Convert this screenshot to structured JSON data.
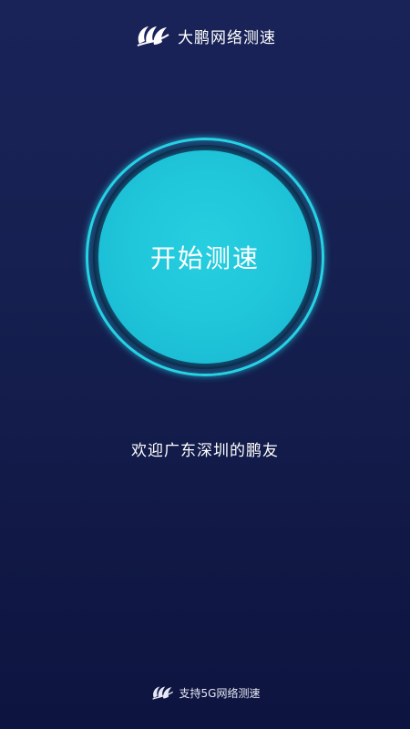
{
  "header": {
    "logo_icon": "dapeng-logo-icon",
    "title": "大鹏网络测速"
  },
  "speedtest": {
    "start_label": "开始测速",
    "accent_color": "#1fc4d9",
    "ring_color": "#27d3e6"
  },
  "welcome_text": "欢迎广东深圳的鹏友",
  "footer": {
    "logo_icon": "dapeng-logo-icon",
    "text": "支持5G网络测速"
  },
  "colors": {
    "background_top": "#1a2358",
    "background_bottom": "#0e1440"
  }
}
